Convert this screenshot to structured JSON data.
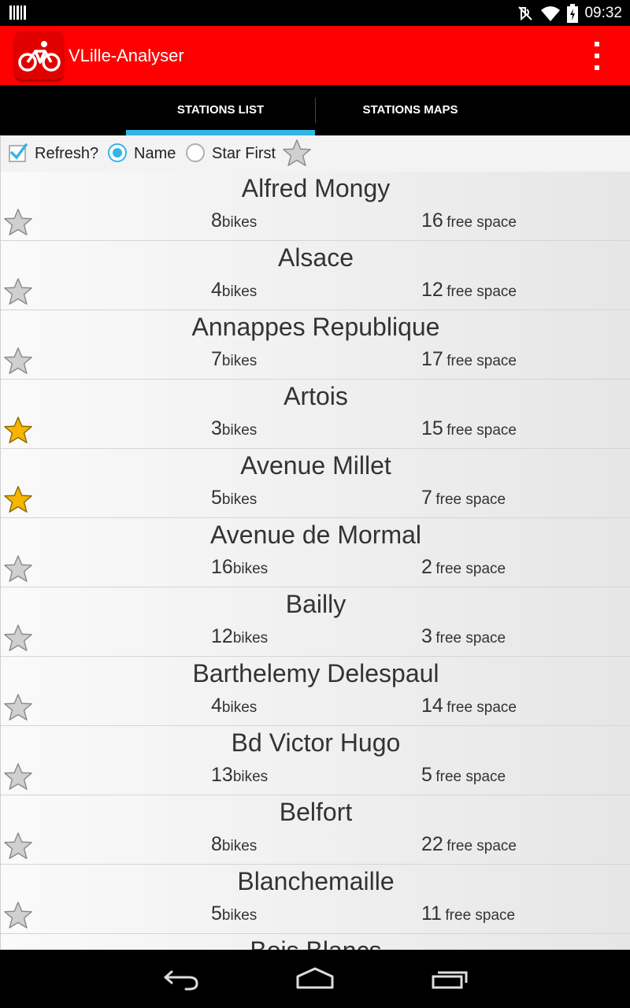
{
  "status_bar": {
    "time": "09:32",
    "icons": [
      "barcode-notification-icon",
      "mute-icon",
      "wifi-icon",
      "battery-charging-icon"
    ]
  },
  "app_bar": {
    "title": "VLille-Analyser",
    "icon": "bicycle-icon",
    "overflow_icon": "overflow-menu-icon",
    "brand_color": "#ff0000"
  },
  "tabs": [
    {
      "label": "STATIONS LIST",
      "selected": true
    },
    {
      "label": "STATIONS MAPS",
      "selected": false
    }
  ],
  "tab_indicator_color": "#33b5e5",
  "options": {
    "refresh_label": "Refresh?",
    "refresh_checked": true,
    "sort_name_label": "Name",
    "sort_name_selected": true,
    "sort_star_label": "Star First",
    "sort_star_selected": false
  },
  "stations": [
    {
      "name": "Alfred Mongy",
      "bikes": "8",
      "free": "16",
      "starred": false
    },
    {
      "name": "Alsace",
      "bikes": "4",
      "free": "12",
      "starred": false
    },
    {
      "name": "Annappes Republique",
      "bikes": "7",
      "free": "17",
      "starred": false
    },
    {
      "name": "Artois",
      "bikes": "3",
      "free": "15",
      "starred": true
    },
    {
      "name": "Avenue Millet",
      "bikes": "5",
      "free": "7",
      "starred": true
    },
    {
      "name": "Avenue de Mormal",
      "bikes": "16",
      "free": "2",
      "starred": false
    },
    {
      "name": "Bailly",
      "bikes": "12",
      "free": "3",
      "starred": false
    },
    {
      "name": "Barthelemy Delespaul",
      "bikes": "4",
      "free": "14",
      "starred": false
    },
    {
      "name": "Bd Victor Hugo",
      "bikes": "13",
      "free": "5",
      "starred": false
    },
    {
      "name": "Belfort",
      "bikes": "8",
      "free": "22",
      "starred": false
    },
    {
      "name": "Blanchemaille",
      "bikes": "5",
      "free": "11",
      "starred": false
    },
    {
      "name": "Bois Blancs",
      "bikes": "",
      "free": "",
      "starred": false
    }
  ],
  "units": {
    "bikes": "bikes",
    "free": "free space"
  },
  "star_colors": {
    "on": "#f7b500",
    "off": "#c8c8c8"
  },
  "nav": {
    "back": "back-icon",
    "home": "home-icon",
    "recents": "recent-apps-icon"
  }
}
